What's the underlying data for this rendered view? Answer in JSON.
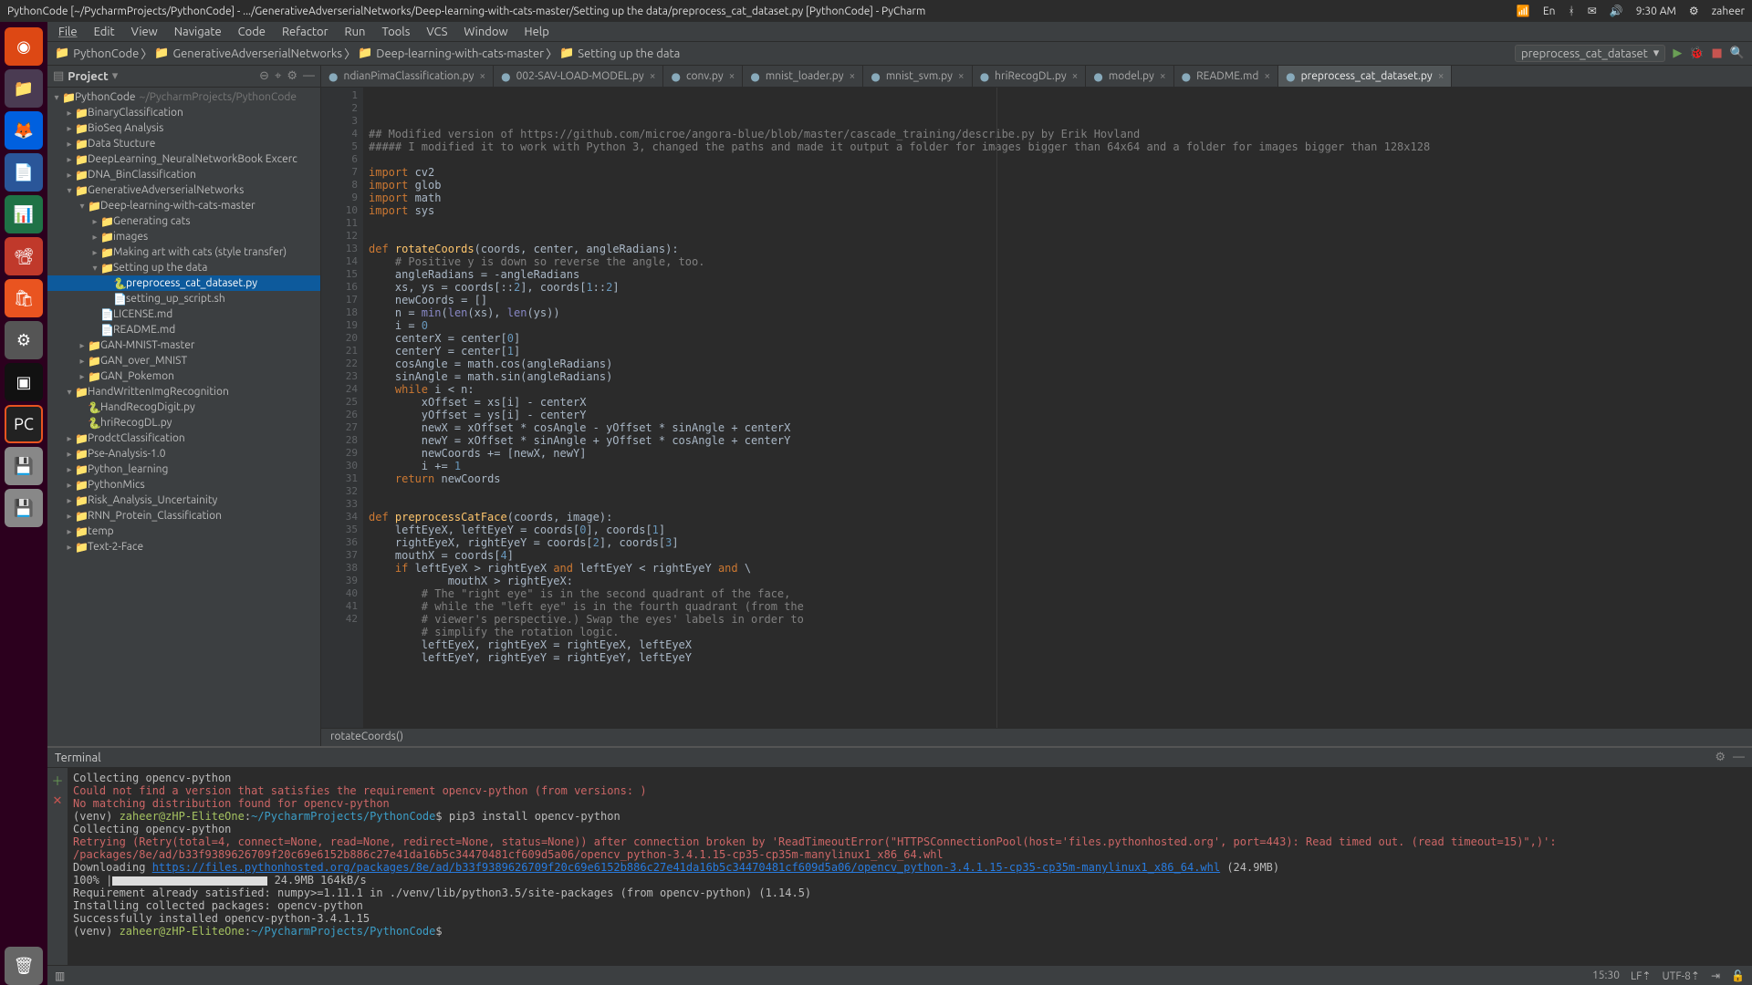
{
  "system": {
    "window_title": "PythonCode [~/PycharmProjects/PythonCode] - .../GenerativeAdverserialNetworks/Deep-learning-with-cats-master/Setting up the data/preprocess_cat_dataset.py [PythonCode] - PyCharm",
    "time": "9:30 AM",
    "user": "zaheer",
    "lang": "En"
  },
  "menubar": [
    "File",
    "Edit",
    "View",
    "Navigate",
    "Code",
    "Refactor",
    "Run",
    "Tools",
    "VCS",
    "Window",
    "Help"
  ],
  "breadcrumbs": [
    "PythonCode",
    "GenerativeAdverserialNetworks",
    "Deep-learning-with-cats-master",
    "Setting up the data"
  ],
  "run_config": "preprocess_cat_dataset",
  "project_panel": {
    "title": "Project"
  },
  "tree": [
    {
      "depth": 0,
      "exp": "▾",
      "ico": "📁",
      "label": "PythonCode",
      "hint": "~/PycharmProjects/PythonCode"
    },
    {
      "depth": 1,
      "exp": "▸",
      "ico": "📁",
      "label": "BinaryClassification"
    },
    {
      "depth": 1,
      "exp": "▸",
      "ico": "📁",
      "label": "BioSeq Analysis"
    },
    {
      "depth": 1,
      "exp": "▸",
      "ico": "📁",
      "label": "Data Stucture"
    },
    {
      "depth": 1,
      "exp": "▸",
      "ico": "📁",
      "label": "DeepLearning_NeuralNetworkBook Excerc"
    },
    {
      "depth": 1,
      "exp": "▸",
      "ico": "📁",
      "label": "DNA_BinClassification"
    },
    {
      "depth": 1,
      "exp": "▾",
      "ico": "📁",
      "label": "GenerativeAdverserialNetworks"
    },
    {
      "depth": 2,
      "exp": "▾",
      "ico": "📁",
      "label": "Deep-learning-with-cats-master"
    },
    {
      "depth": 3,
      "exp": "▸",
      "ico": "📁",
      "label": "Generating cats"
    },
    {
      "depth": 3,
      "exp": "▸",
      "ico": "📁",
      "label": "images"
    },
    {
      "depth": 3,
      "exp": "▸",
      "ico": "📁",
      "label": "Making art with cats (style transfer)"
    },
    {
      "depth": 3,
      "exp": "▾",
      "ico": "📁",
      "label": "Setting up the data"
    },
    {
      "depth": 4,
      "exp": "",
      "ico": "🐍",
      "label": "preprocess_cat_dataset.py",
      "sel": true
    },
    {
      "depth": 4,
      "exp": "",
      "ico": "📄",
      "label": "setting_up_script.sh"
    },
    {
      "depth": 3,
      "exp": "",
      "ico": "📄",
      "label": "LICENSE.md"
    },
    {
      "depth": 3,
      "exp": "",
      "ico": "📄",
      "label": "README.md"
    },
    {
      "depth": 2,
      "exp": "▸",
      "ico": "📁",
      "label": "GAN-MNIST-master"
    },
    {
      "depth": 2,
      "exp": "▸",
      "ico": "📁",
      "label": "GAN_over_MNIST"
    },
    {
      "depth": 2,
      "exp": "▸",
      "ico": "📁",
      "label": "GAN_Pokemon"
    },
    {
      "depth": 1,
      "exp": "▾",
      "ico": "📁",
      "label": "HandWrittenImgRecognition"
    },
    {
      "depth": 2,
      "exp": "",
      "ico": "🐍",
      "label": "HandRecogDigit.py"
    },
    {
      "depth": 2,
      "exp": "",
      "ico": "🐍",
      "label": "hriRecogDL.py"
    },
    {
      "depth": 1,
      "exp": "▸",
      "ico": "📁",
      "label": "ProdctClassification"
    },
    {
      "depth": 1,
      "exp": "▸",
      "ico": "📁",
      "label": "Pse-Analysis-1.0"
    },
    {
      "depth": 1,
      "exp": "▸",
      "ico": "📁",
      "label": "Python_learning"
    },
    {
      "depth": 1,
      "exp": "▸",
      "ico": "📁",
      "label": "PythonMics"
    },
    {
      "depth": 1,
      "exp": "▸",
      "ico": "📁",
      "label": "Risk_Analysis_Uncertainity"
    },
    {
      "depth": 1,
      "exp": "▸",
      "ico": "📁",
      "label": "RNN_Protein_Classification"
    },
    {
      "depth": 1,
      "exp": "▸",
      "ico": "📁",
      "label": "temp"
    },
    {
      "depth": 1,
      "exp": "▸",
      "ico": "📁",
      "label": "Text-2-Face"
    }
  ],
  "tabs": [
    {
      "label": "ndianPimaClassification.py",
      "active": false
    },
    {
      "label": "002-SAV-LOAD-MODEL.py",
      "active": false
    },
    {
      "label": "conv.py",
      "active": false
    },
    {
      "label": "mnist_loader.py",
      "active": false
    },
    {
      "label": "mnist_svm.py",
      "active": false
    },
    {
      "label": "hriRecogDL.py",
      "active": false
    },
    {
      "label": "model.py",
      "active": false
    },
    {
      "label": "README.md",
      "active": false
    },
    {
      "label": "preprocess_cat_dataset.py",
      "active": true
    }
  ],
  "code": {
    "first_line": 1,
    "lines": [
      {
        "t": "comment",
        "text": "## Modified version of https://github.com/microe/angora-blue/blob/master/cascade_training/describe.py by Erik Hovland"
      },
      {
        "t": "comment",
        "text": "##### I modified it to work with Python 3, changed the paths and made it output a folder for images bigger than 64x64 and a folder for images bigger than 128x128"
      },
      {
        "t": "blank",
        "text": ""
      },
      {
        "t": "import",
        "text": "import cv2"
      },
      {
        "t": "import",
        "text": "import glob"
      },
      {
        "t": "import",
        "text": "import math"
      },
      {
        "t": "import",
        "text": "import sys"
      },
      {
        "t": "blank",
        "text": ""
      },
      {
        "t": "blank",
        "text": ""
      },
      {
        "t": "def",
        "text": "def rotateCoords(coords, center, angleRadians):"
      },
      {
        "t": "comment",
        "text": "    # Positive y is down so reverse the angle, too."
      },
      {
        "t": "body",
        "text": "    angleRadians = -angleRadians"
      },
      {
        "t": "body",
        "text": "    xs, ys = coords[::2], coords[1::2]"
      },
      {
        "t": "body",
        "text": "    newCoords = []"
      },
      {
        "t": "body",
        "text": "    n = min(len(xs), len(ys))"
      },
      {
        "t": "body",
        "text": "    i = 0"
      },
      {
        "t": "body",
        "text": "    centerX = center[0]"
      },
      {
        "t": "body",
        "text": "    centerY = center[1]"
      },
      {
        "t": "body",
        "text": "    cosAngle = math.cos(angleRadians)"
      },
      {
        "t": "body",
        "text": "    sinAngle = math.sin(angleRadians)"
      },
      {
        "t": "while",
        "text": "    while i < n:"
      },
      {
        "t": "body",
        "text": "        xOffset = xs[i] - centerX"
      },
      {
        "t": "body",
        "text": "        yOffset = ys[i] - centerY"
      },
      {
        "t": "body",
        "text": "        newX = xOffset * cosAngle - yOffset * sinAngle + centerX"
      },
      {
        "t": "body",
        "text": "        newY = xOffset * sinAngle + yOffset * cosAngle + centerY"
      },
      {
        "t": "body",
        "text": "        newCoords += [newX, newY]"
      },
      {
        "t": "body",
        "text": "        i += 1"
      },
      {
        "t": "return",
        "text": "    return newCoords"
      },
      {
        "t": "blank",
        "text": ""
      },
      {
        "t": "blank",
        "text": ""
      },
      {
        "t": "def",
        "text": "def preprocessCatFace(coords, image):"
      },
      {
        "t": "body",
        "text": "    leftEyeX, leftEyeY = coords[0], coords[1]"
      },
      {
        "t": "body",
        "text": "    rightEyeX, rightEyeY = coords[2], coords[3]"
      },
      {
        "t": "body",
        "text": "    mouthX = coords[4]"
      },
      {
        "t": "if",
        "text": "    if leftEyeX > rightEyeX and leftEyeY < rightEyeY and \\"
      },
      {
        "t": "body",
        "text": "            mouthX > rightEyeX:"
      },
      {
        "t": "comment",
        "text": "        # The \"right eye\" is in the second quadrant of the face,"
      },
      {
        "t": "comment",
        "text": "        # while the \"left eye\" is in the fourth quadrant (from the"
      },
      {
        "t": "comment",
        "text": "        # viewer's perspective.) Swap the eyes' labels in order to"
      },
      {
        "t": "comment",
        "text": "        # simplify the rotation logic."
      },
      {
        "t": "body",
        "text": "        leftEyeX, rightEyeX = rightEyeX, leftEyeX"
      },
      {
        "t": "body",
        "text": "        leftEyeY, rightEyeY = rightEyeY, leftEyeY"
      }
    ]
  },
  "editor_breadcrumb": "rotateCoords()",
  "terminal": {
    "title": "Terminal",
    "lines": [
      {
        "cls": "t-white",
        "text": "Collecting opencv-python"
      },
      {
        "cls": "t-red",
        "text": "  Could not find a version that satisfies the requirement opencv-python (from versions: )"
      },
      {
        "cls": "t-red",
        "text": "No matching distribution found for opencv-python"
      },
      {
        "cls": "prompt",
        "venv": "(venv) ",
        "user": "zaheer@zHP-EliteOne",
        "path": "~/PycharmProjects/PythonCode",
        "cmd": "pip3 install opencv-python"
      },
      {
        "cls": "t-white",
        "text": "Collecting opencv-python"
      },
      {
        "cls": "t-red",
        "text": "  Retrying (Retry(total=4, connect=None, read=None, redirect=None, status=None)) after connection broken by 'ReadTimeoutError(\"HTTPSConnectionPool(host='files.pythonhosted.org', port=443): Read timed out. (read timeout=15)\",)': /packages/8e/ad/b33f9389626709f20c69e6152b886c27e41da16b5c34470481cf609d5a06/opencv_python-3.4.1.15-cp35-cp35m-manylinux1_x86_64.whl"
      },
      {
        "cls": "download",
        "prefix": "  Downloading ",
        "link": "https://files.pythonhosted.org/packages/8e/ad/b33f9389626709f20c69e6152b886c27e41da16b5c34470481cf609d5a06/opencv_python-3.4.1.15-cp35-cp35m-manylinux1_x86_64.whl",
        "suffix": " (24.9MB)"
      },
      {
        "cls": "progress",
        "pct": "    100% |",
        "rate": " 24.9MB 164kB/s"
      },
      {
        "cls": "t-white",
        "text": "Requirement already satisfied: numpy>=1.11.1 in ./venv/lib/python3.5/site-packages (from opencv-python) (1.14.5)"
      },
      {
        "cls": "t-white",
        "text": "Installing collected packages: opencv-python"
      },
      {
        "cls": "t-white",
        "text": "Successfully installed opencv-python-3.4.1.15"
      },
      {
        "cls": "prompt",
        "venv": "(venv) ",
        "user": "zaheer@zHP-EliteOne",
        "path": "~/PycharmProjects/PythonCode",
        "cmd": ""
      }
    ]
  },
  "statusbar": {
    "pos": "15:30",
    "lf": "LF",
    "enc": "UTF-8",
    "ind": "⇥"
  }
}
